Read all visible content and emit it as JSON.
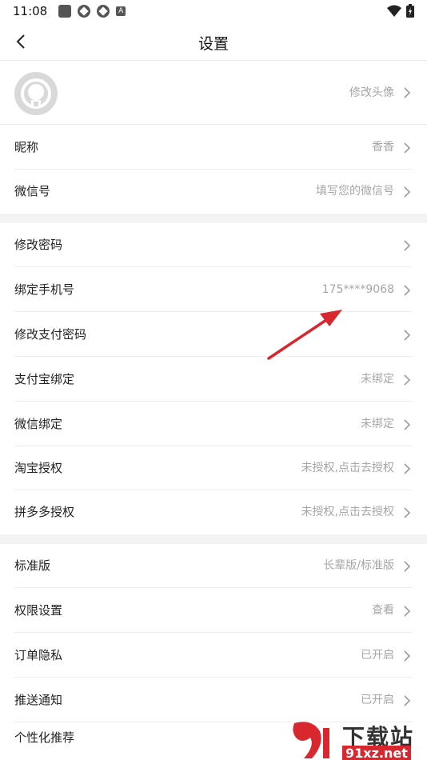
{
  "status_bar": {
    "time": "11:08",
    "badge": "A"
  },
  "header": {
    "title": "设置"
  },
  "avatar_row": {
    "value": "修改头像"
  },
  "group1": [
    {
      "label": "昵称",
      "value": "香香"
    },
    {
      "label": "微信号",
      "value": "填写您的微信号"
    }
  ],
  "group2": [
    {
      "label": "修改密码",
      "value": ""
    },
    {
      "label": "绑定手机号",
      "value": "175****9068"
    },
    {
      "label": "修改支付密码",
      "value": ""
    },
    {
      "label": "支付宝绑定",
      "value": "未绑定"
    },
    {
      "label": "微信绑定",
      "value": "未绑定"
    },
    {
      "label": "淘宝授权",
      "value": "未授权,点击去授权"
    },
    {
      "label": "拼多多授权",
      "value": "未授权,点击去授权"
    }
  ],
  "group3": [
    {
      "label": "标准版",
      "value": "长辈版/标准版"
    },
    {
      "label": "权限设置",
      "value": "查看"
    },
    {
      "label": "订单隐私",
      "value": "已开启"
    },
    {
      "label": "推送通知",
      "value": "已开启"
    },
    {
      "label": "个性化推荐",
      "value": ""
    }
  ],
  "watermark": {
    "tagline": "下载站",
    "domain": "91xz.net"
  },
  "colors": {
    "arrow": "#d8272f",
    "value_text": "#a6a6a6",
    "section_gap": "#f3f3f3"
  },
  "icons": {
    "back": "chevron-left-icon",
    "row_arrow": "chevron-right-icon",
    "avatar": "default-avatar-icon"
  }
}
